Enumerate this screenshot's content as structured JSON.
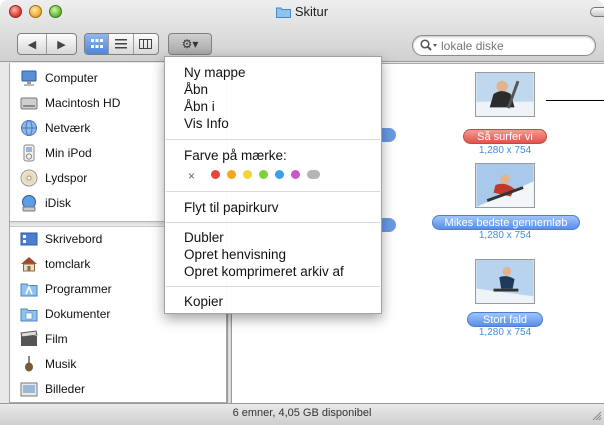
{
  "window": {
    "title": "Skitur",
    "status_text": "6 emner, 4,05 GB disponibel"
  },
  "toolbar": {
    "back_label": "◀",
    "forward_label": "▶",
    "action_label": "⚙▾",
    "search_placeholder": "lokale diske"
  },
  "sidebar": {
    "devices": [
      {
        "label": "Computer",
        "icon": "computer-icon"
      },
      {
        "label": "Macintosh HD",
        "icon": "hard-drive-icon"
      },
      {
        "label": "Netværk",
        "icon": "network-globe-icon"
      },
      {
        "label": "Min iPod",
        "icon": "ipod-icon"
      },
      {
        "label": "Lydspor",
        "icon": "cd-icon"
      },
      {
        "label": "iDisk",
        "icon": "idisk-icon"
      }
    ],
    "places": [
      {
        "label": "Skrivebord",
        "icon": "desktop-icon"
      },
      {
        "label": "tomclark",
        "icon": "home-icon"
      },
      {
        "label": "Programmer",
        "icon": "applications-icon"
      },
      {
        "label": "Dokumenter",
        "icon": "documents-folder-icon"
      },
      {
        "label": "Film",
        "icon": "movies-icon"
      },
      {
        "label": "Musik",
        "icon": "music-icon"
      },
      {
        "label": "Billeder",
        "icon": "pictures-icon"
      }
    ]
  },
  "context_menu": {
    "group1": [
      "Ny mappe",
      "Åbn",
      "Åbn i",
      "Vis Info"
    ],
    "color_label_heading": "Farve på mærke:",
    "clear_label": "×",
    "label_colors": [
      "#e8453c",
      "#f5a623",
      "#f2d33a",
      "#7ed13a",
      "#3aa0e8",
      "#c957c9",
      "#b5b5b5"
    ],
    "trash_item": "Flyt til papirkurv",
    "group3": [
      "Dubler",
      "Opret henvisning",
      "Opret komprimeret  arkiv af"
    ],
    "copy_item": "Kopier"
  },
  "files": [
    {
      "name": "Så surfer vi",
      "dims": "1,280 x 754",
      "label_color": "red"
    },
    {
      "name": "Mikes bedste gennemløb",
      "dims": "1,280 x 754",
      "label_color": "blue"
    },
    {
      "name": "Stort fald",
      "dims": "1,280 x 754",
      "label_color": "blue"
    }
  ]
}
